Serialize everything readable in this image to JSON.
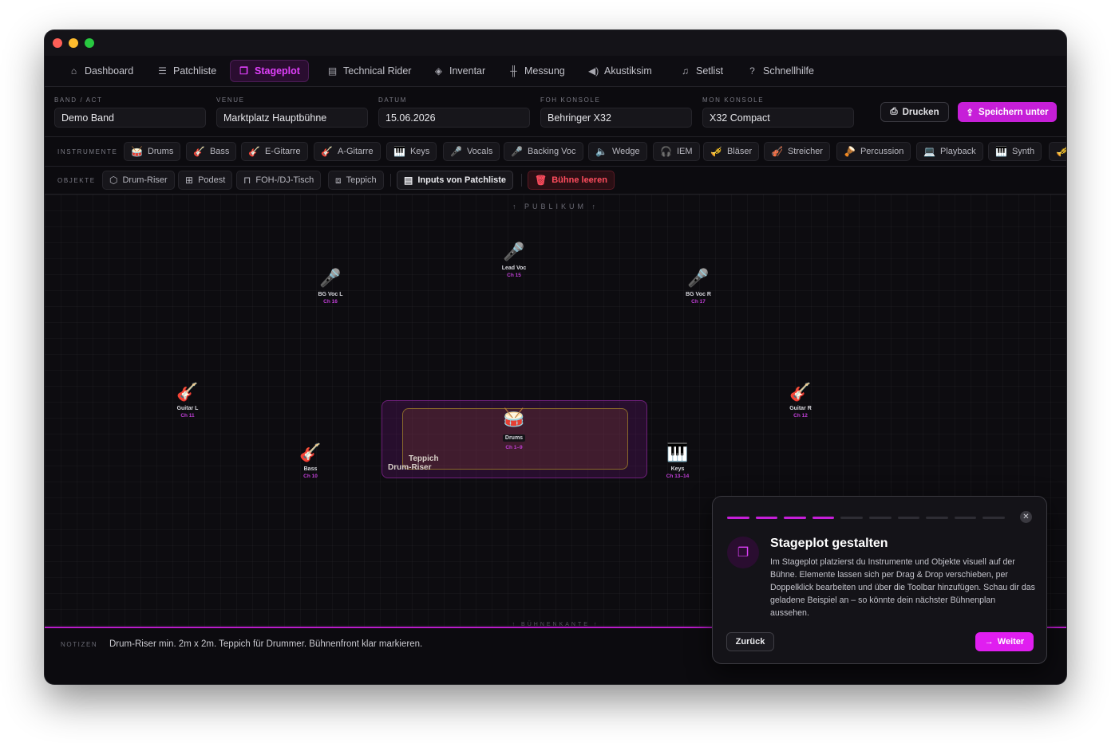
{
  "nav": [
    {
      "label": "Dashboard",
      "icon": "home-icon",
      "glyph": "⌂"
    },
    {
      "label": "Patchliste",
      "icon": "list-icon",
      "glyph": "☰"
    },
    {
      "label": "Stageplot",
      "icon": "stageplot-icon",
      "glyph": "❐",
      "active": true
    },
    {
      "label": "Technical Rider",
      "icon": "document-icon",
      "glyph": "▤"
    },
    {
      "label": "Inventar",
      "icon": "box-icon",
      "glyph": "◈"
    },
    {
      "label": "Messung",
      "icon": "waveform-icon",
      "glyph": "╫"
    },
    {
      "label": "Akustiksim",
      "icon": "speaker-icon",
      "glyph": "◀)"
    },
    {
      "label": "Setlist",
      "icon": "music-list-icon",
      "glyph": "♫"
    },
    {
      "label": "Schnellhilfe",
      "icon": "help-icon",
      "glyph": "?"
    }
  ],
  "meta": {
    "band_label": "BAND / ACT",
    "band": "Demo Band",
    "venue_label": "VENUE",
    "venue": "Marktplatz Hauptbühne",
    "date_label": "DATUM",
    "date": "15.06.2026",
    "foh_label": "FOH KONSOLE",
    "foh": "Behringer X32",
    "mon_label": "MON KONSOLE",
    "mon": "X32 Compact",
    "print_label": "Drucken",
    "save_label": "Speichern unter"
  },
  "instruments_label": "INSTRUMENTE",
  "instruments": [
    {
      "label": "Drums",
      "icon": "drum-icon",
      "glyph": "🥁"
    },
    {
      "label": "Bass",
      "icon": "guitar-icon",
      "glyph": "🎸"
    },
    {
      "label": "E-Gitarre",
      "icon": "guitar-icon",
      "glyph": "🎸"
    },
    {
      "label": "A-Gitarre",
      "icon": "guitar-icon",
      "glyph": "🎸"
    },
    {
      "label": "Keys",
      "icon": "piano-icon",
      "glyph": "🎹"
    },
    {
      "label": "Vocals",
      "icon": "microphone-icon",
      "glyph": "🎤"
    },
    {
      "label": "Backing Voc",
      "icon": "microphone-icon",
      "glyph": "🎤"
    },
    {
      "label": "Wedge",
      "icon": "speaker-icon",
      "glyph": "🔈"
    },
    {
      "label": "IEM",
      "icon": "headphones-icon",
      "glyph": "🎧"
    },
    {
      "label": "Bläser",
      "icon": "trumpet-icon",
      "glyph": "🎺"
    },
    {
      "label": "Streicher",
      "icon": "violin-icon",
      "glyph": "🎻"
    },
    {
      "label": "Percussion",
      "icon": "percussion-icon",
      "glyph": "🪘"
    },
    {
      "label": "Playback",
      "icon": "laptop-icon",
      "glyph": "💻"
    },
    {
      "label": "Synth",
      "icon": "piano-icon",
      "glyph": "🎹"
    }
  ],
  "objects_label": "OBJEKTE",
  "objects": [
    {
      "label": "Drum-Riser",
      "icon": "riser-icon",
      "glyph": "⬡"
    },
    {
      "label": "Podest",
      "icon": "podest-icon",
      "glyph": "⊞"
    },
    {
      "label": "FOH-/DJ-Tisch",
      "icon": "table-icon",
      "glyph": "⊓"
    },
    {
      "label": "Teppich",
      "icon": "rug-icon",
      "glyph": "⧈"
    }
  ],
  "import_label": "Inputs von Patchliste",
  "clear_label": "Bühne leeren",
  "stage": {
    "audience": "↑   PUBLIKUM   ↑",
    "edge": "↑ BÜHNENKANTE ↑",
    "rug_label": "Teppich",
    "riser_label": "Drum-Riser",
    "items": [
      {
        "name": "Lead Voc",
        "ch": "Ch 15",
        "glyph": "🎤",
        "icon": "microphone-icon"
      },
      {
        "name": "BG Voc L",
        "ch": "Ch 16",
        "glyph": "🎤",
        "icon": "microphone-icon"
      },
      {
        "name": "BG Voc R",
        "ch": "Ch 17",
        "glyph": "🎤",
        "icon": "microphone-icon"
      },
      {
        "name": "Guitar L",
        "ch": "Ch 11",
        "glyph": "🎸",
        "icon": "guitar-icon"
      },
      {
        "name": "Guitar R",
        "ch": "Ch 12",
        "glyph": "🎸",
        "icon": "guitar-icon"
      },
      {
        "name": "Drums",
        "ch": "Ch 1–9",
        "glyph": "🥁",
        "icon": "drum-icon"
      },
      {
        "name": "Bass",
        "ch": "Ch 10",
        "glyph": "🎸",
        "icon": "guitar-icon"
      },
      {
        "name": "Keys",
        "ch": "Ch 13–14",
        "glyph": "🎹",
        "icon": "piano-icon"
      }
    ]
  },
  "notes": {
    "label": "NOTIZEN",
    "text": "Drum-Riser min. 2m x 2m. Teppich für Drummer. Bühnenfront klar markieren."
  },
  "tour": {
    "title": "Stageplot gestalten",
    "body": "Im Stageplot platzierst du Instrumente und Objekte visuell auf der Bühne. Elemente lassen sich per Drag & Drop verschieben, per Doppelklick bearbeiten und über die Toolbar hinzufügen. Schau dir das geladene Beispiel an – so könnte dein nächster Bühnenplan aussehen.",
    "back": "Zurück",
    "next": "Weiter",
    "step": 4,
    "total": 10
  },
  "colors": {
    "accent": "#c61fd8",
    "danger": "#ff4d5e",
    "background": "#0c0b0f"
  }
}
